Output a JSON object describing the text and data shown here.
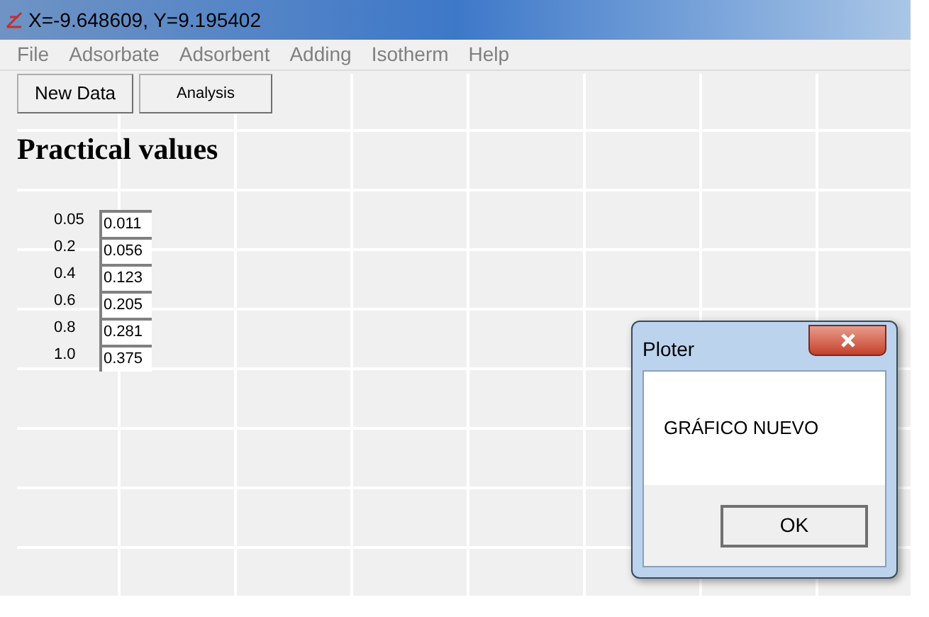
{
  "window": {
    "title": "X=-9.648609, Y=9.195402"
  },
  "menu": [
    "File",
    "Adsorbate",
    "Adsorbent",
    "Adding",
    "Isotherm",
    "Help"
  ],
  "toolbar": {
    "buttons": [
      "New Data",
      "Analysis"
    ]
  },
  "heading": "Practical values",
  "values": [
    {
      "label": "0.05",
      "value": "0.011"
    },
    {
      "label": "0.2",
      "value": "0.056"
    },
    {
      "label": "0.4",
      "value": "0.123"
    },
    {
      "label": "0.6",
      "value": "0.205"
    },
    {
      "label": "0.8",
      "value": "0.281"
    },
    {
      "label": "1.0",
      "value": "0.375"
    }
  ],
  "dialog": {
    "title": "Ploter",
    "message": "GRÁFICO NUEVO",
    "buttons": [
      "OK"
    ]
  }
}
